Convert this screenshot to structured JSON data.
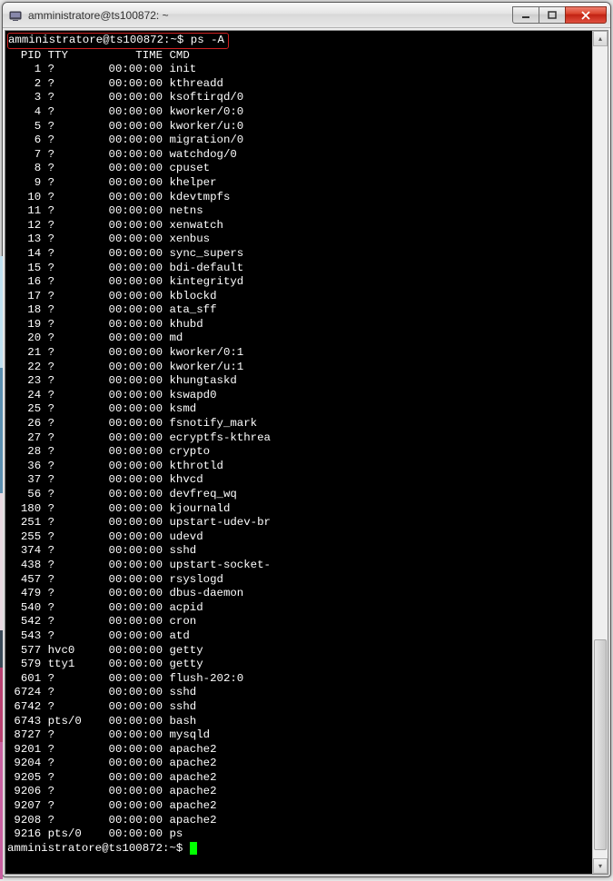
{
  "window": {
    "title": "amministratore@ts100872: ~"
  },
  "terminal": {
    "prompt_line": "amministratore@ts100872:~$ ps -A",
    "header": "  PID TTY          TIME CMD",
    "rows": [
      {
        "pid": "1",
        "tty": "?",
        "time": "00:00:00",
        "cmd": "init"
      },
      {
        "pid": "2",
        "tty": "?",
        "time": "00:00:00",
        "cmd": "kthreadd"
      },
      {
        "pid": "3",
        "tty": "?",
        "time": "00:00:00",
        "cmd": "ksoftirqd/0"
      },
      {
        "pid": "4",
        "tty": "?",
        "time": "00:00:00",
        "cmd": "kworker/0:0"
      },
      {
        "pid": "5",
        "tty": "?",
        "time": "00:00:00",
        "cmd": "kworker/u:0"
      },
      {
        "pid": "6",
        "tty": "?",
        "time": "00:00:00",
        "cmd": "migration/0"
      },
      {
        "pid": "7",
        "tty": "?",
        "time": "00:00:00",
        "cmd": "watchdog/0"
      },
      {
        "pid": "8",
        "tty": "?",
        "time": "00:00:00",
        "cmd": "cpuset"
      },
      {
        "pid": "9",
        "tty": "?",
        "time": "00:00:00",
        "cmd": "khelper"
      },
      {
        "pid": "10",
        "tty": "?",
        "time": "00:00:00",
        "cmd": "kdevtmpfs"
      },
      {
        "pid": "11",
        "tty": "?",
        "time": "00:00:00",
        "cmd": "netns"
      },
      {
        "pid": "12",
        "tty": "?",
        "time": "00:00:00",
        "cmd": "xenwatch"
      },
      {
        "pid": "13",
        "tty": "?",
        "time": "00:00:00",
        "cmd": "xenbus"
      },
      {
        "pid": "14",
        "tty": "?",
        "time": "00:00:00",
        "cmd": "sync_supers"
      },
      {
        "pid": "15",
        "tty": "?",
        "time": "00:00:00",
        "cmd": "bdi-default"
      },
      {
        "pid": "16",
        "tty": "?",
        "time": "00:00:00",
        "cmd": "kintegrityd"
      },
      {
        "pid": "17",
        "tty": "?",
        "time": "00:00:00",
        "cmd": "kblockd"
      },
      {
        "pid": "18",
        "tty": "?",
        "time": "00:00:00",
        "cmd": "ata_sff"
      },
      {
        "pid": "19",
        "tty": "?",
        "time": "00:00:00",
        "cmd": "khubd"
      },
      {
        "pid": "20",
        "tty": "?",
        "time": "00:00:00",
        "cmd": "md"
      },
      {
        "pid": "21",
        "tty": "?",
        "time": "00:00:00",
        "cmd": "kworker/0:1"
      },
      {
        "pid": "22",
        "tty": "?",
        "time": "00:00:00",
        "cmd": "kworker/u:1"
      },
      {
        "pid": "23",
        "tty": "?",
        "time": "00:00:00",
        "cmd": "khungtaskd"
      },
      {
        "pid": "24",
        "tty": "?",
        "time": "00:00:00",
        "cmd": "kswapd0"
      },
      {
        "pid": "25",
        "tty": "?",
        "time": "00:00:00",
        "cmd": "ksmd"
      },
      {
        "pid": "26",
        "tty": "?",
        "time": "00:00:00",
        "cmd": "fsnotify_mark"
      },
      {
        "pid": "27",
        "tty": "?",
        "time": "00:00:00",
        "cmd": "ecryptfs-kthrea"
      },
      {
        "pid": "28",
        "tty": "?",
        "time": "00:00:00",
        "cmd": "crypto"
      },
      {
        "pid": "36",
        "tty": "?",
        "time": "00:00:00",
        "cmd": "kthrotld"
      },
      {
        "pid": "37",
        "tty": "?",
        "time": "00:00:00",
        "cmd": "khvcd"
      },
      {
        "pid": "56",
        "tty": "?",
        "time": "00:00:00",
        "cmd": "devfreq_wq"
      },
      {
        "pid": "180",
        "tty": "?",
        "time": "00:00:00",
        "cmd": "kjournald"
      },
      {
        "pid": "251",
        "tty": "?",
        "time": "00:00:00",
        "cmd": "upstart-udev-br"
      },
      {
        "pid": "255",
        "tty": "?",
        "time": "00:00:00",
        "cmd": "udevd"
      },
      {
        "pid": "374",
        "tty": "?",
        "time": "00:00:00",
        "cmd": "sshd"
      },
      {
        "pid": "438",
        "tty": "?",
        "time": "00:00:00",
        "cmd": "upstart-socket-"
      },
      {
        "pid": "457",
        "tty": "?",
        "time": "00:00:00",
        "cmd": "rsyslogd"
      },
      {
        "pid": "479",
        "tty": "?",
        "time": "00:00:00",
        "cmd": "dbus-daemon"
      },
      {
        "pid": "540",
        "tty": "?",
        "time": "00:00:00",
        "cmd": "acpid"
      },
      {
        "pid": "542",
        "tty": "?",
        "time": "00:00:00",
        "cmd": "cron"
      },
      {
        "pid": "543",
        "tty": "?",
        "time": "00:00:00",
        "cmd": "atd"
      },
      {
        "pid": "577",
        "tty": "hvc0",
        "time": "00:00:00",
        "cmd": "getty"
      },
      {
        "pid": "579",
        "tty": "tty1",
        "time": "00:00:00",
        "cmd": "getty"
      },
      {
        "pid": "601",
        "tty": "?",
        "time": "00:00:00",
        "cmd": "flush-202:0"
      },
      {
        "pid": "6724",
        "tty": "?",
        "time": "00:00:00",
        "cmd": "sshd"
      },
      {
        "pid": "6742",
        "tty": "?",
        "time": "00:00:00",
        "cmd": "sshd"
      },
      {
        "pid": "6743",
        "tty": "pts/0",
        "time": "00:00:00",
        "cmd": "bash"
      },
      {
        "pid": "8727",
        "tty": "?",
        "time": "00:00:00",
        "cmd": "mysqld"
      },
      {
        "pid": "9201",
        "tty": "?",
        "time": "00:00:00",
        "cmd": "apache2"
      },
      {
        "pid": "9204",
        "tty": "?",
        "time": "00:00:00",
        "cmd": "apache2"
      },
      {
        "pid": "9205",
        "tty": "?",
        "time": "00:00:00",
        "cmd": "apache2"
      },
      {
        "pid": "9206",
        "tty": "?",
        "time": "00:00:00",
        "cmd": "apache2"
      },
      {
        "pid": "9207",
        "tty": "?",
        "time": "00:00:00",
        "cmd": "apache2"
      },
      {
        "pid": "9208",
        "tty": "?",
        "time": "00:00:00",
        "cmd": "apache2"
      },
      {
        "pid": "9216",
        "tty": "pts/0",
        "time": "00:00:00",
        "cmd": "ps"
      }
    ],
    "footer_prompt": "amministratore@ts100872:~$ "
  }
}
